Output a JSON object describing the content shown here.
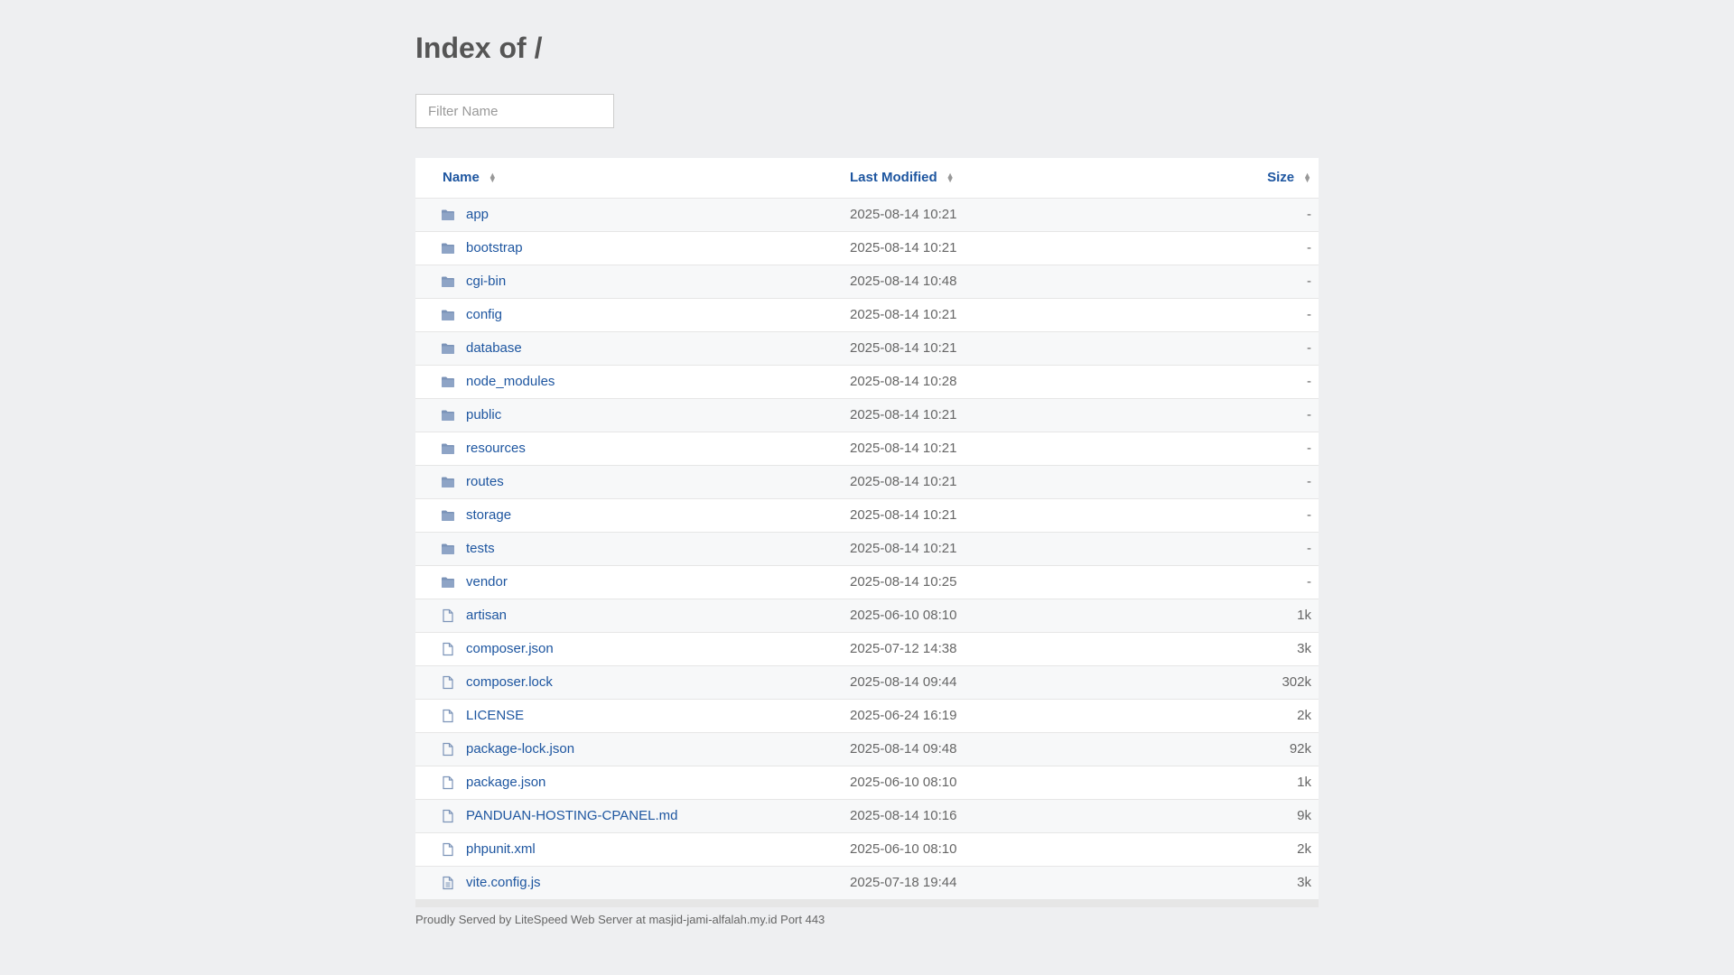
{
  "page": {
    "title": "Index of /"
  },
  "filter": {
    "placeholder": "Filter Name"
  },
  "table": {
    "headers": {
      "name": "Name",
      "modified": "Last Modified",
      "size": "Size"
    },
    "rows": [
      {
        "name": "app",
        "modified": "2025-08-14 10:21",
        "size": "-",
        "type": "folder"
      },
      {
        "name": "bootstrap",
        "modified": "2025-08-14 10:21",
        "size": "-",
        "type": "folder"
      },
      {
        "name": "cgi-bin",
        "modified": "2025-08-14 10:48",
        "size": "-",
        "type": "folder"
      },
      {
        "name": "config",
        "modified": "2025-08-14 10:21",
        "size": "-",
        "type": "folder"
      },
      {
        "name": "database",
        "modified": "2025-08-14 10:21",
        "size": "-",
        "type": "folder"
      },
      {
        "name": "node_modules",
        "modified": "2025-08-14 10:28",
        "size": "-",
        "type": "folder"
      },
      {
        "name": "public",
        "modified": "2025-08-14 10:21",
        "size": "-",
        "type": "folder"
      },
      {
        "name": "resources",
        "modified": "2025-08-14 10:21",
        "size": "-",
        "type": "folder"
      },
      {
        "name": "routes",
        "modified": "2025-08-14 10:21",
        "size": "-",
        "type": "folder"
      },
      {
        "name": "storage",
        "modified": "2025-08-14 10:21",
        "size": "-",
        "type": "folder"
      },
      {
        "name": "tests",
        "modified": "2025-08-14 10:21",
        "size": "-",
        "type": "folder"
      },
      {
        "name": "vendor",
        "modified": "2025-08-14 10:25",
        "size": "-",
        "type": "folder"
      },
      {
        "name": "artisan",
        "modified": "2025-06-10 08:10",
        "size": "1k",
        "type": "file"
      },
      {
        "name": "composer.json",
        "modified": "2025-07-12 14:38",
        "size": "3k",
        "type": "file"
      },
      {
        "name": "composer.lock",
        "modified": "2025-08-14 09:44",
        "size": "302k",
        "type": "file"
      },
      {
        "name": "LICENSE",
        "modified": "2025-06-24 16:19",
        "size": "2k",
        "type": "file"
      },
      {
        "name": "package-lock.json",
        "modified": "2025-08-14 09:48",
        "size": "92k",
        "type": "file"
      },
      {
        "name": "package.json",
        "modified": "2025-06-10 08:10",
        "size": "1k",
        "type": "file"
      },
      {
        "name": "PANDUAN-HOSTING-CPANEL.md",
        "modified": "2025-08-14 10:16",
        "size": "9k",
        "type": "file"
      },
      {
        "name": "phpunit.xml",
        "modified": "2025-06-10 08:10",
        "size": "2k",
        "type": "file"
      },
      {
        "name": "vite.config.js",
        "modified": "2025-07-18 19:44",
        "size": "3k",
        "type": "file-text"
      }
    ]
  },
  "footer": {
    "text": "Proudly Served by LiteSpeed Web Server at masjid-jami-alfalah.my.id Port 443"
  },
  "colors": {
    "link": "#1e56a0",
    "folder_icon": "#7b93b8",
    "file_icon": "#7b93b8",
    "background": "#eeeff1"
  },
  "icons": {
    "folder": "folder-icon",
    "file": "file-icon",
    "file-text": "file-text-icon",
    "sort": "sort-icon"
  }
}
